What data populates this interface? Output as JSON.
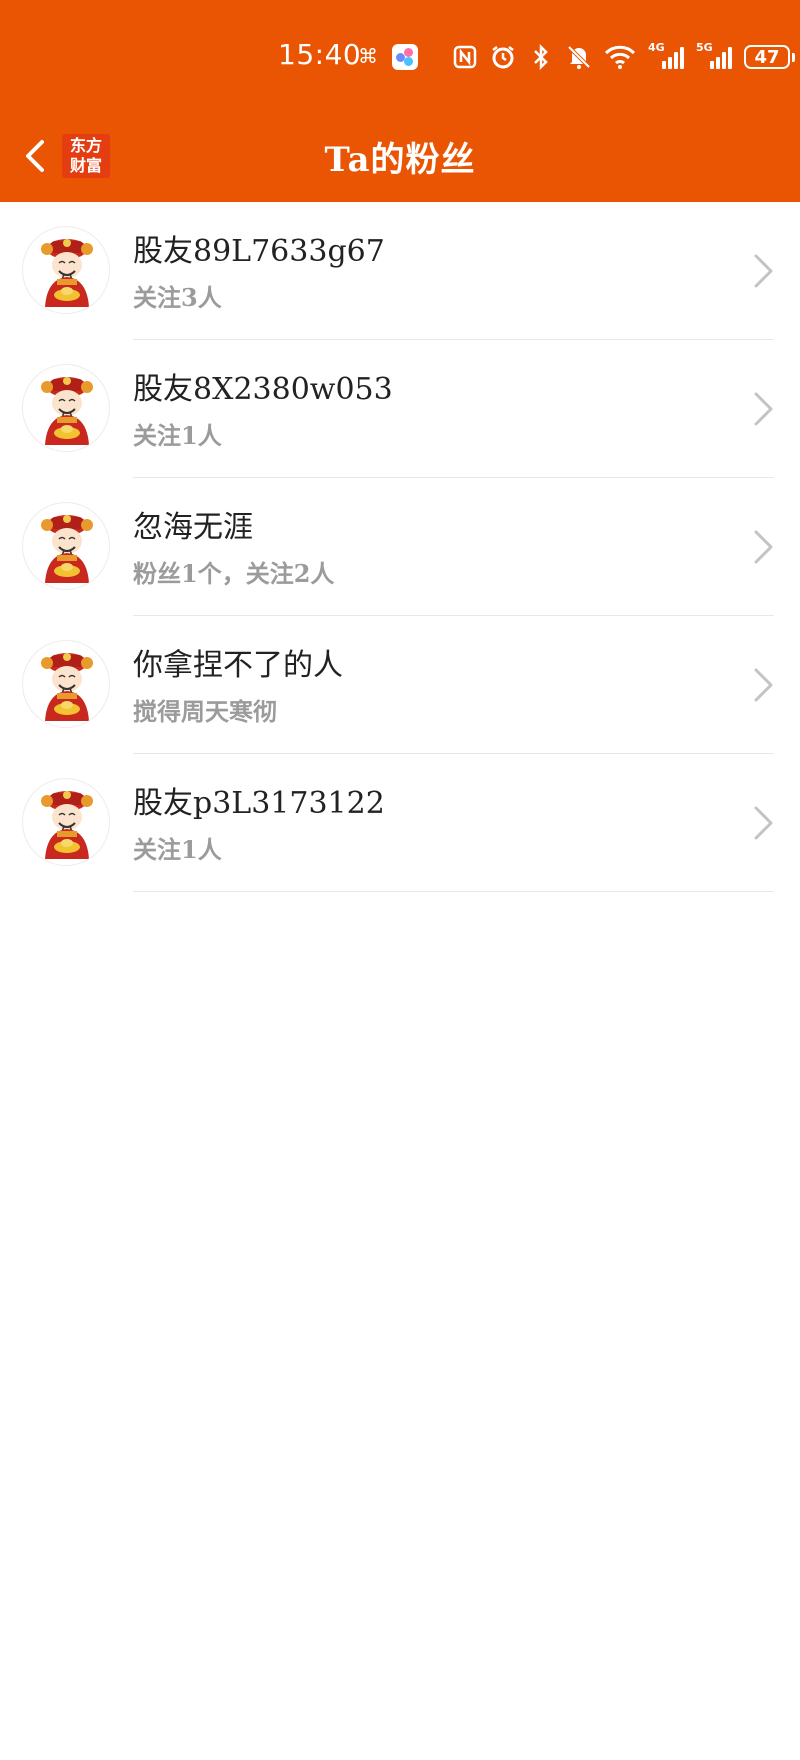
{
  "status_bar": {
    "time": "15:40",
    "battery": "47",
    "network_1": "4G",
    "network_2": "5G",
    "icons": [
      "link-icon",
      "app-icon",
      "nfc-icon",
      "alarm-icon",
      "bluetooth-icon",
      "mute-icon",
      "wifi-icon",
      "signal-icon",
      "battery-icon"
    ]
  },
  "header": {
    "title": "Ta的粉丝",
    "logo_line1": "东方",
    "logo_line2": "财富",
    "accent_color": "#ea5504"
  },
  "fans": [
    {
      "name": "股友89L7633g67",
      "subtitle": "关注3人"
    },
    {
      "name": "股友8X2380w053",
      "subtitle": "关注1人"
    },
    {
      "name": "忽海无涯",
      "subtitle": "粉丝1个，关注2人"
    },
    {
      "name": "你拿捏不了的人",
      "subtitle": "搅得周天寒彻"
    },
    {
      "name": "股友p3L3173122",
      "subtitle": "关注1人"
    }
  ]
}
